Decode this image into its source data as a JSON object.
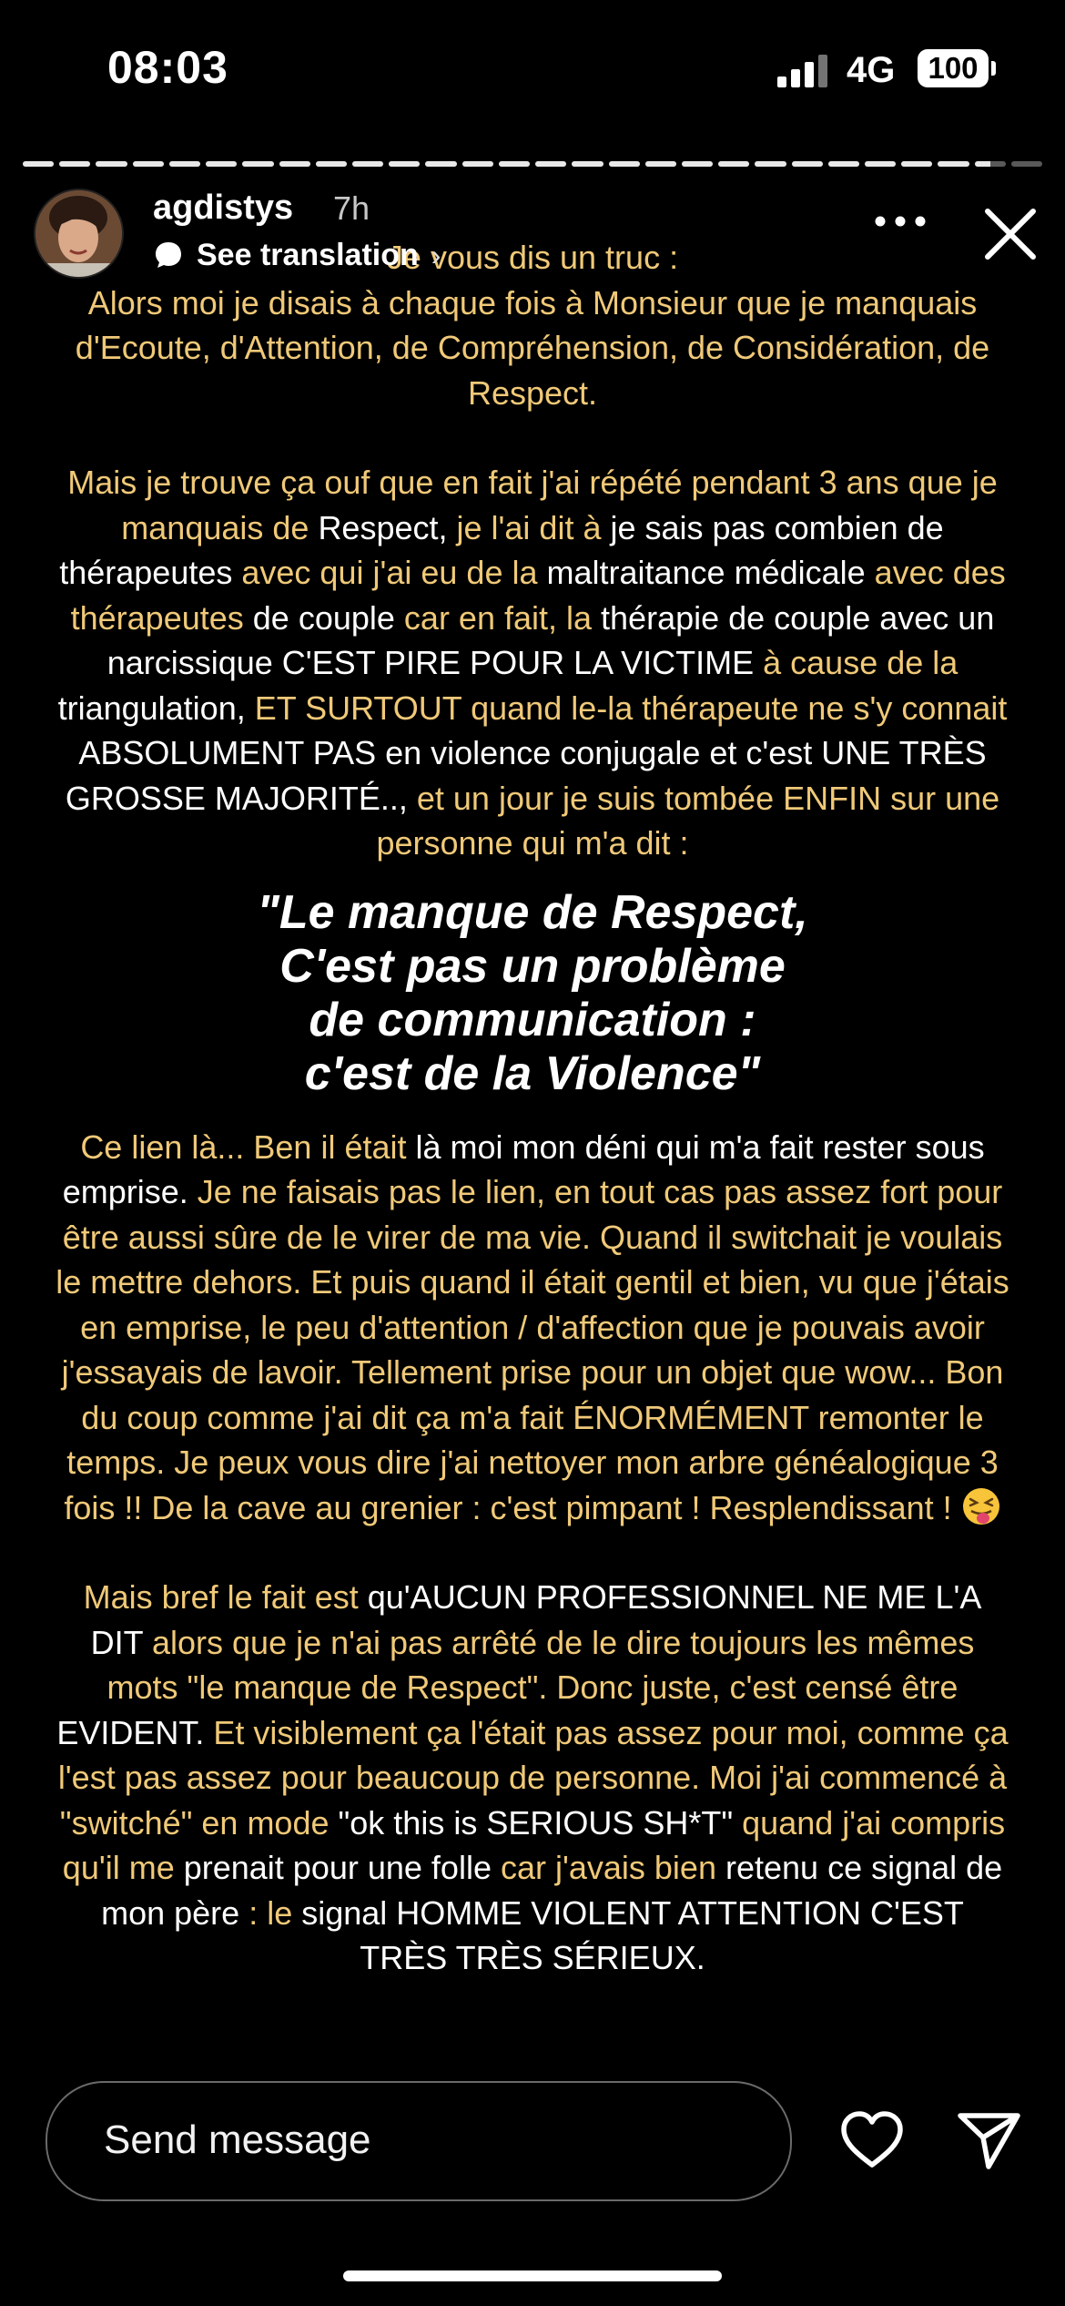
{
  "status_bar": {
    "time": "08:03",
    "network": "4G",
    "battery": "100"
  },
  "story_progress": {
    "segments": 28,
    "completed": 26,
    "current_fraction": 0.5
  },
  "header": {
    "username": "agdistys",
    "time_ago": "7h",
    "see_translation": "See translation",
    "chevron": "›",
    "more_icon": "more-horizontal-icon",
    "close_icon": "close-icon"
  },
  "story": {
    "intro_line": "Je vous dis un truc :",
    "para1": "Alors moi je disais à chaque fois à Monsieur que je manquais d'Ecoute, d'Attention, de Compréhension, de Considération, de Respect.",
    "para2": [
      {
        "t": "Mais je trouve ça ouf que en fait j'ai répété pendant 3 ans que je manquais de ",
        "c": "y"
      },
      {
        "t": "Respect, ",
        "c": "w"
      },
      {
        "t": "je l'ai dit à ",
        "c": "y"
      },
      {
        "t": "je sais pas combien de thérapeutes ",
        "c": "w"
      },
      {
        "t": "avec qui j'ai eu de la ",
        "c": "y"
      },
      {
        "t": "maltraitance médicale ",
        "c": "w"
      },
      {
        "t": "avec des thérapeutes ",
        "c": "y"
      },
      {
        "t": "de couple ",
        "c": "w"
      },
      {
        "t": "car en fait, la ",
        "c": "y"
      },
      {
        "t": "thérapie de couple avec un narcissique C'EST PIRE POUR LA VICTIME ",
        "c": "w"
      },
      {
        "t": "à cause de la ",
        "c": "y"
      },
      {
        "t": "triangulation, ",
        "c": "w"
      },
      {
        "t": "ET SURTOUT quand le-la thérapeute ne s'y connait ",
        "c": "y"
      },
      {
        "t": "ABSOLUMENT PAS en violence conjugale et c'est UNE TRÈS GROSSE MAJORITÉ.., ",
        "c": "w"
      },
      {
        "t": "et un jour je suis tombée ENFIN sur une personne qui m'a dit :",
        "c": "y"
      }
    ],
    "quote_lines": [
      "\"Le manque de Respect,",
      "C'est pas un problème",
      "de communication :",
      "c'est de la Violence\""
    ],
    "para3": [
      {
        "t": "Ce lien là... Ben il était ",
        "c": "y"
      },
      {
        "t": "là moi mon déni qui m'a fait rester sous emprise. ",
        "c": "w"
      },
      {
        "t": "Je ne faisais pas le lien, en tout cas pas assez fort pour être aussi sûre de le virer de ma vie. Quand il switchait je voulais le mettre dehors. Et puis quand il était gentil et bien, vu que j'étais en emprise, le peu d'attention / d'affection que je pouvais avoir j'essayais de lavoir. Tellement prise pour un objet que wow... Bon du coup comme j'ai dit ça m'a fait ÉNORMÉMENT remonter le temps. Je peux vous dire j'ai nettoyer mon arbre généalogique 3 fois !!  De la cave au grenier : c'est pimpant ! Resplendissant ! ",
        "c": "y"
      }
    ],
    "para3_emoji": "tongue-out-emoji",
    "para4": [
      {
        "t": "Mais bref le fait est ",
        "c": "y"
      },
      {
        "t": "qu'AUCUN PROFESSIONNEL NE ME L'A DIT ",
        "c": "w"
      },
      {
        "t": " alors que je n'ai pas arrêté de le dire toujours les mêmes mots \"le manque de Respect\". Donc juste, c'est censé être ",
        "c": "y"
      },
      {
        "t": "EVIDENT. ",
        "c": "w"
      },
      {
        "t": "Et visiblement ça l'était pas assez pour moi, comme ça l'est pas assez pour beaucoup de personne. Moi j'ai commencé à \"switché\" en mode ",
        "c": "y"
      },
      {
        "t": "\"ok this is SERIOUS SH*T\" ",
        "c": "w"
      },
      {
        "t": "quand j'ai compris qu'il me ",
        "c": "y"
      },
      {
        "t": "prenait pour une folle ",
        "c": "w"
      },
      {
        "t": "car j'avais bien ",
        "c": "y"
      },
      {
        "t": "retenu ce signal de mon père ",
        "c": "w"
      },
      {
        "t": ": le ",
        "c": "y"
      },
      {
        "t": "signal HOMME VIOLENT ATTENTION C'EST TRÈS TRÈS SÉRIEUX.",
        "c": "w"
      }
    ]
  },
  "footer": {
    "message_placeholder": "Send message",
    "heart_icon": "heart-icon",
    "send_icon": "send-icon"
  },
  "colors": {
    "accent_text": "#f0c978",
    "background": "#000000"
  }
}
